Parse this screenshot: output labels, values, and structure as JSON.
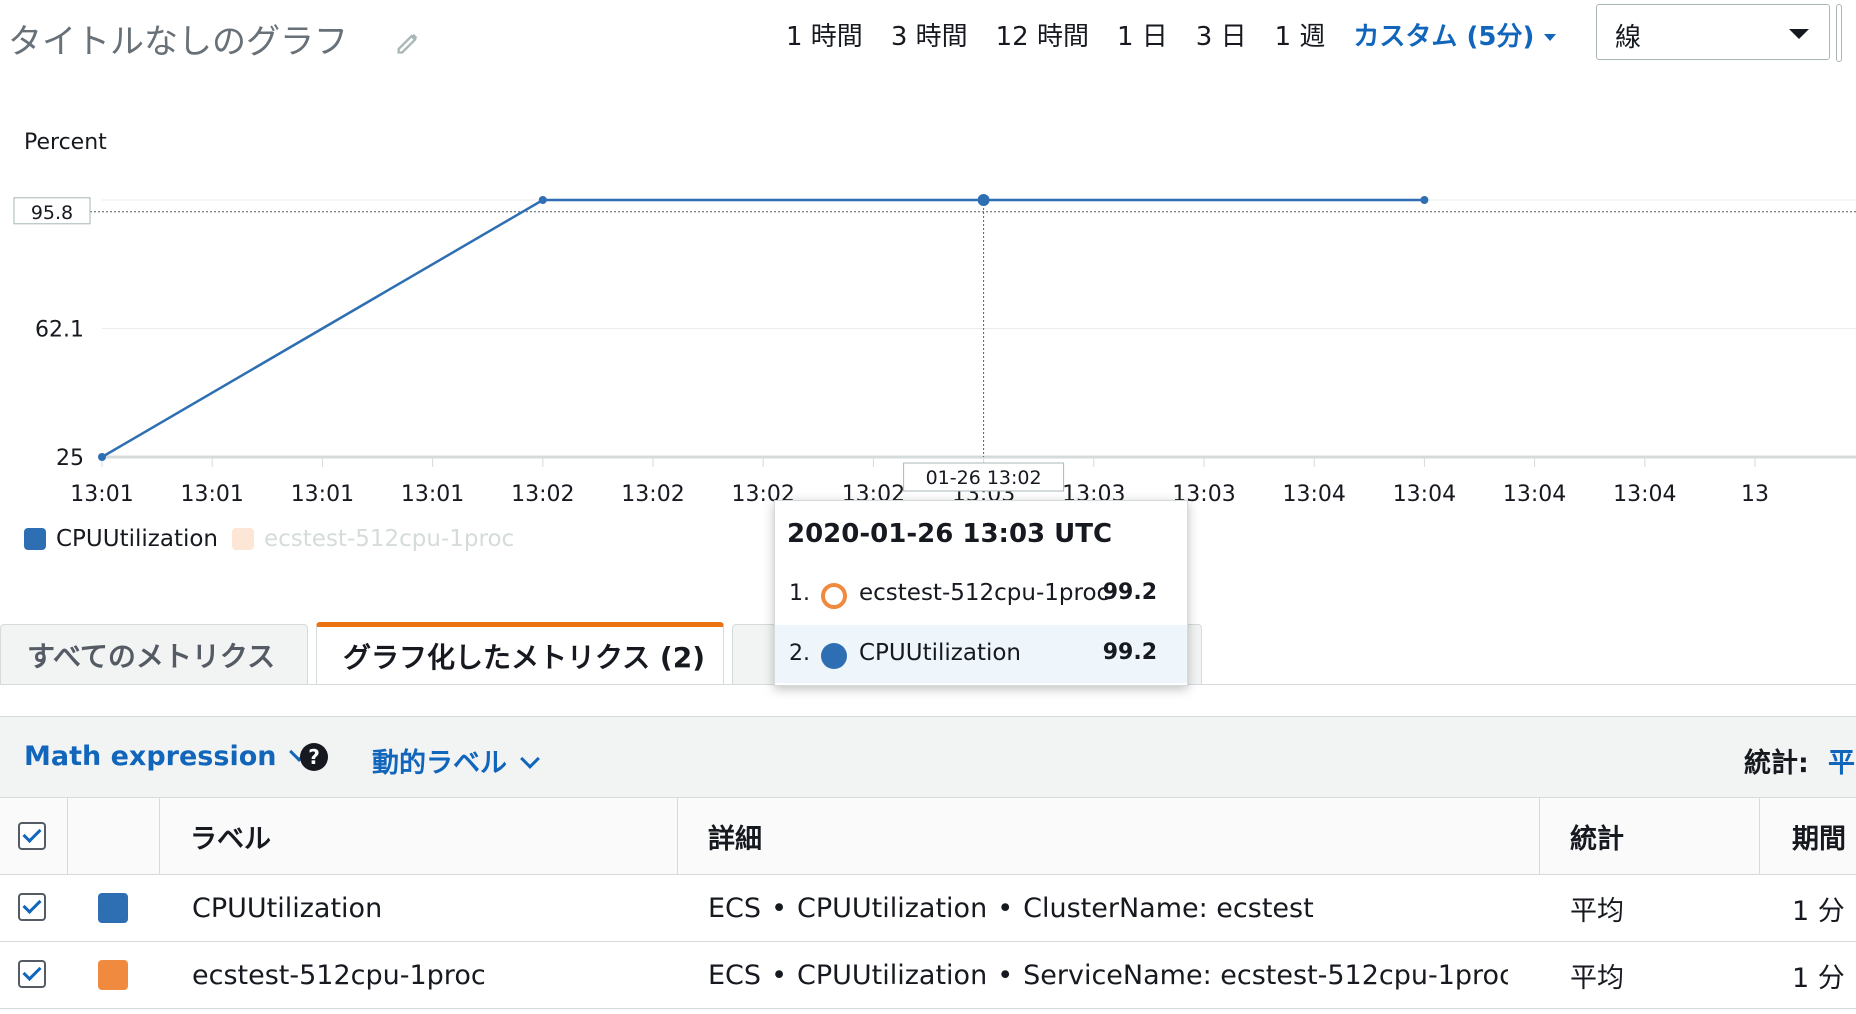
{
  "header": {
    "title": "タイトルなしのグラフ",
    "time_ranges": [
      "1 時間",
      "3 時間",
      "12 時間",
      "1 日",
      "3 日",
      "1 週"
    ],
    "custom_range": "カスタム (5分)",
    "chart_type": "線"
  },
  "chart_data": {
    "type": "line",
    "ylabel": "Percent",
    "y_ticks": [
      "62.1",
      "25"
    ],
    "y_ticks_values": [
      62.1,
      25
    ],
    "ylim": [
      25,
      99.2
    ],
    "hover_y_label": "95.8",
    "hover_y_value": 95.8,
    "x_tick_labels": [
      "13:01",
      "13:01",
      "13:01",
      "13:01",
      "13:02",
      "13:02",
      "13:02",
      "13:02",
      "13:03",
      "13:03",
      "13:03",
      "13:04",
      "13:04",
      "13:04",
      "13:04",
      "13"
    ],
    "crosshair_label": "01-26 13:02",
    "series": [
      {
        "name": "CPUUtilization",
        "color": "#2e6fb3",
        "points": [
          {
            "x": 0,
            "y": 25
          },
          {
            "x": 4,
            "y": 99.2
          },
          {
            "x": 8,
            "y": 99.2
          },
          {
            "x": 12,
            "y": 99.2
          }
        ]
      },
      {
        "name": "ecstest-512cpu-1proc",
        "color": "#ff8c2a",
        "hidden": true,
        "points": []
      }
    ]
  },
  "legend": {
    "items": [
      {
        "label": "CPUUtilization",
        "color": "#2e6fb3"
      },
      {
        "label": "ecstest-512cpu-1proc",
        "color": "#fde6d6"
      }
    ]
  },
  "tooltip": {
    "header": "2020-01-26 13:03 UTC",
    "rows": [
      {
        "num": "1.",
        "name": "ecstest-512cpu-1proc",
        "value": "99.2"
      },
      {
        "num": "2.",
        "name": "CPUUtilization",
        "value": "99.2"
      }
    ]
  },
  "tabs": [
    "すべてのメトリクス",
    "グラフ化したメトリクス (2)"
  ],
  "toolbar": {
    "math_expression": "Math expression",
    "dynamic_label": "動的ラベル",
    "stat_label": "統計:",
    "stat_value": "平"
  },
  "table": {
    "headers": [
      "ラベル",
      "詳細",
      "統計",
      "期間"
    ],
    "rows": [
      {
        "color": "#2e6fb3",
        "label": "CPUUtilization",
        "detail_ns": "ECS",
        "detail_metric": "CPUUtilization",
        "detail_dim": "ClusterName: ecstest",
        "stat": "平均",
        "period": "1 分"
      },
      {
        "color": "#f08a3e",
        "label": "ecstest-512cpu-1proc",
        "detail_ns": "ECS",
        "detail_metric": "CPUUtilization",
        "detail_dim": "ServiceName: ecstest-512cpu-1proc…",
        "stat": "平均",
        "period": "1 分"
      }
    ]
  }
}
